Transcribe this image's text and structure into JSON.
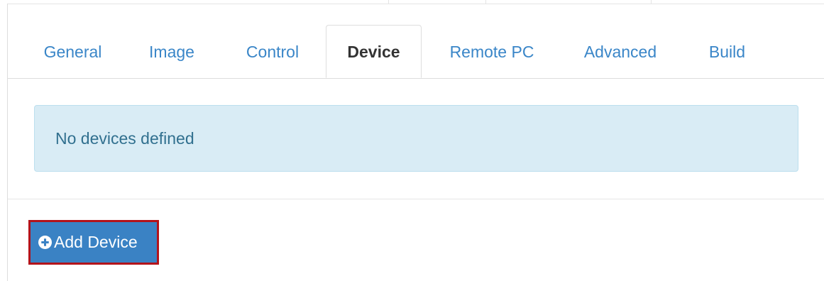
{
  "tabs": {
    "items": [
      {
        "label": "General"
      },
      {
        "label": "Image"
      },
      {
        "label": "Control"
      },
      {
        "label": "Device",
        "active": true
      },
      {
        "label": "Remote PC"
      },
      {
        "label": "Advanced"
      },
      {
        "label": "Build"
      }
    ]
  },
  "alert": {
    "message": "No devices defined"
  },
  "actions": {
    "add_device_label": "Add Device",
    "add_device_icon": "plus-circle-icon"
  },
  "colors": {
    "link": "#3a86c8",
    "active_tab_text": "#333333",
    "alert_background": "#d9ecf5",
    "alert_text": "#31708f",
    "button_background": "#3a82c4",
    "highlight_border": "#b3131b"
  }
}
